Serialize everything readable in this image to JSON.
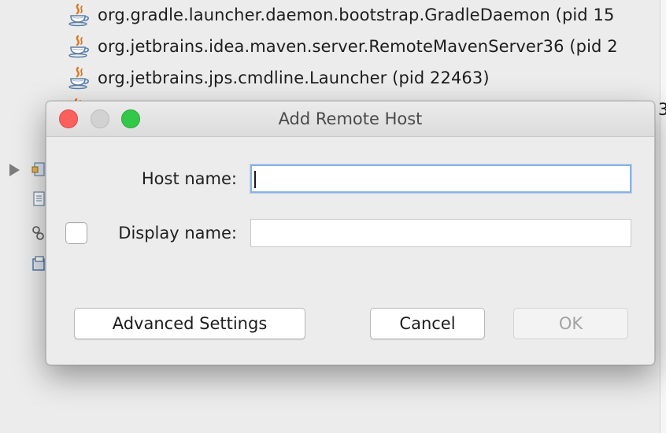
{
  "background": {
    "processes": [
      {
        "label": "org.gradle.launcher.daemon.bootstrap.GradleDaemon (pid 15",
        "icon": "java-icon"
      },
      {
        "label": "org.jetbrains.idea.maven.server.RemoteMavenServer36 (pid 2",
        "icon": "java-icon"
      },
      {
        "label": "org.jetbrains.jps.cmdline.Launcher (pid 22463)",
        "icon": "java-icon"
      },
      {
        "label": "3",
        "icon": "java-icon"
      }
    ]
  },
  "dialog": {
    "title": "Add Remote Host",
    "host_name_label": "Host name:",
    "host_name_value": "",
    "display_name_label": "Display name:",
    "display_name_value": "",
    "display_name_checked": false,
    "buttons": {
      "advanced": "Advanced Settings",
      "cancel": "Cancel",
      "ok": "OK"
    }
  },
  "colors": {
    "close": "#fc605c",
    "minimize": "#d2d2d2",
    "zoom": "#34c84a",
    "focus_ring": "#8cb2e2"
  }
}
